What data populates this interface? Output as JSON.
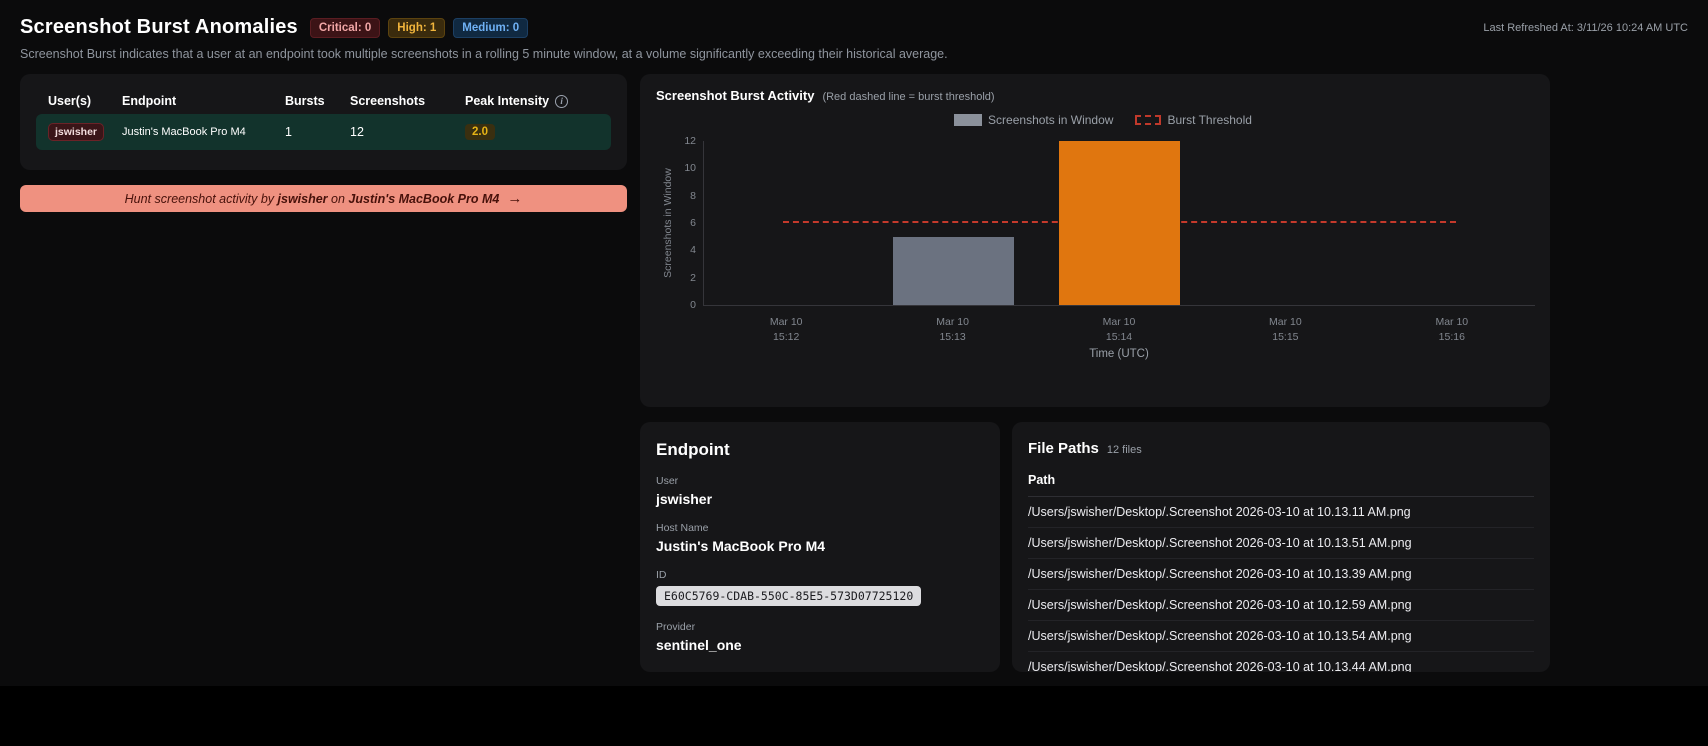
{
  "header": {
    "title": "Screenshot Burst Anomalies",
    "badges": {
      "critical": "Critical: 0",
      "high": "High: 1",
      "medium": "Medium: 0"
    },
    "last_refreshed": "Last Refreshed At: 3/11/26 10:24 AM UTC",
    "subtitle": "Screenshot Burst indicates that a user at an endpoint took multiple screenshots in a rolling 5 minute window, at a volume significantly exceeding their historical average."
  },
  "anomaly_table": {
    "headers": {
      "users": "User(s)",
      "endpoint": "Endpoint",
      "bursts": "Bursts",
      "screenshots": "Screenshots",
      "peak_intensity": "Peak Intensity"
    },
    "row": {
      "user": "jswisher",
      "endpoint": "Justin's MacBook Pro M4",
      "bursts": "1",
      "screenshots": "12",
      "peak_intensity": "2.0"
    }
  },
  "hunt_banner": {
    "prefix": "Hunt screenshot activity by ",
    "user": "jswisher",
    "connector": " on ",
    "endpoint": "Justin's MacBook Pro M4",
    "arrow": "→"
  },
  "chart_data": {
    "type": "bar",
    "title": "Screenshot Burst Activity",
    "subtitle": "(Red dashed line = burst threshold)",
    "ylabel": "Screenshots in Window",
    "xlabel": "Time (UTC)",
    "ylim": [
      0,
      12
    ],
    "yticks": [
      0,
      2,
      4,
      6,
      8,
      10,
      12
    ],
    "categories": [
      "Mar 10\n15:12",
      "Mar 10\n15:13",
      "Mar 10\n15:14",
      "Mar 10\n15:15",
      "Mar 10\n15:16"
    ],
    "values": [
      0,
      5,
      12,
      0,
      0
    ],
    "bar_colors": [
      "#6b7280",
      "#6b7280",
      "#e0760f",
      "#6b7280",
      "#6b7280"
    ],
    "bar_width_pct": 14.5,
    "threshold": 6,
    "grid": false,
    "legend_position": "top",
    "legend": [
      {
        "label": "Screenshots in Window",
        "type": "bar",
        "color": "#8b919b"
      },
      {
        "label": "Burst Threshold",
        "type": "dashed",
        "color": "#c0392b"
      }
    ]
  },
  "endpoint_card": {
    "title": "Endpoint",
    "user_label": "User",
    "user_value": "jswisher",
    "host_label": "Host Name",
    "host_value": "Justin's MacBook Pro M4",
    "id_label": "ID",
    "id_value": "E60C5769-CDAB-550C-85E5-573D07725120",
    "provider_label": "Provider",
    "provider_value": "sentinel_one"
  },
  "file_paths_card": {
    "title": "File Paths",
    "count": "12 files",
    "column": "Path",
    "items": [
      "/Users/jswisher/Desktop/.Screenshot 2026-03-10 at 10.13.11 AM.png",
      "/Users/jswisher/Desktop/.Screenshot 2026-03-10 at 10.13.51 AM.png",
      "/Users/jswisher/Desktop/.Screenshot 2026-03-10 at 10.13.39 AM.png",
      "/Users/jswisher/Desktop/.Screenshot 2026-03-10 at 10.12.59 AM.png",
      "/Users/jswisher/Desktop/.Screenshot 2026-03-10 at 10.13.54 AM.png",
      "/Users/jswisher/Desktop/.Screenshot 2026-03-10 at 10.13.44 AM.png"
    ]
  }
}
